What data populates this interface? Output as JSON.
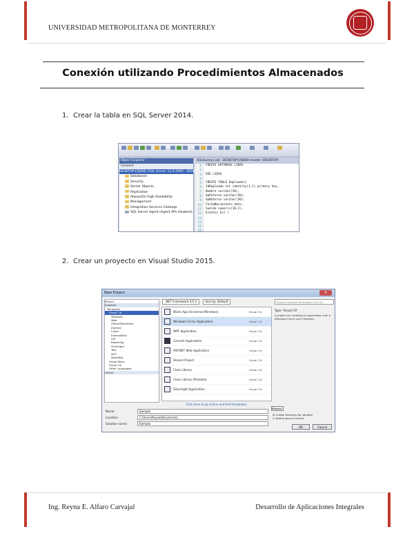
{
  "header": {
    "university": "UNIVERSIDAD METROPOLITANA DE MONTERREY",
    "seal_color": "#b32025",
    "accent_color": "#c0392b"
  },
  "title": "Conexión utilizando Procedimientos Almacenados",
  "steps": [
    {
      "number": "1.",
      "text": "Crear la tabla en SQL Server 2014."
    },
    {
      "number": "2.",
      "text": "Crear un proyecto en Visual Studio 2015."
    }
  ],
  "ssms": {
    "explorer_title": "Object Explorer",
    "connect_label": "Connect",
    "server_node": "DESKTOP-E9JSKR (SQL Server 12.0.2000 - DESKTOP)",
    "tree": [
      "Databases",
      "Security",
      "Server Objects",
      "Replication",
      "AlwaysOn High Availability",
      "Management",
      "Integration Services Catalogs",
      "SQL Server Agent (Agent XPs disabled)"
    ],
    "tab_label": "SQLQuery1.sql - DESKTOP-E9JSKR.master (DESKTOP)",
    "line_numbers": [
      "1",
      "2",
      "3",
      "4",
      "5",
      "6",
      "7",
      "8",
      "9",
      "10",
      "11",
      "12",
      "13",
      "14",
      "15",
      "16"
    ],
    "code": {
      "l1": "CREATE DATABASE LIDAS",
      "l2": "USE LIDAS",
      "l3": "CREATE TABLE Empleados(",
      "l4": "IdEmpleado int identity(1,1) primary key,",
      "l5": "Nombre varchar(50),",
      "l6": "ApPaterno varchar(50),",
      "l7": "ApMaterno varchar(50),",
      "l8": "FechaNacimiento date,",
      "l9": "Sueldo numeric(18,2),",
      "l10": "Estatus bit )"
    }
  },
  "vs": {
    "caption": "New Project",
    "close": "X",
    "tree": [
      "Recent",
      "Installed",
      "Templates",
      "Visual C#",
      "Windows",
      "Web",
      "Office/SharePoint",
      "Android",
      "Cloud",
      "Extensibility",
      "iOS",
      "Reporting",
      "Silverlight",
      "Test",
      "WCF",
      "Workflow",
      "Visual Basic",
      "Visual F#",
      "Other Languages",
      "Online"
    ],
    "tree_selected": "Visual C#",
    "framework": ".NET Framework 4.5.2",
    "sort": "Sort by: Default",
    "search_placeholder": "Search Installed Templates (Ctrl+E)",
    "templates": [
      {
        "name": "Blank App (Universal Windows)",
        "lang": "Visual C#"
      },
      {
        "name": "Windows Forms Application",
        "lang": "Visual C#"
      },
      {
        "name": "WPF Application",
        "lang": "Visual C#"
      },
      {
        "name": "Console Application",
        "lang": "Visual C#"
      },
      {
        "name": "ASP.NET Web Application",
        "lang": "Visual C#"
      },
      {
        "name": "Shared Project",
        "lang": "Visual C#"
      },
      {
        "name": "Class Library",
        "lang": "Visual C#"
      },
      {
        "name": "Class Library (Portable)",
        "lang": "Visual C#"
      },
      {
        "name": "Silverlight Application",
        "lang": "Visual C#"
      }
    ],
    "online_link": "Click here to go online and find templates.",
    "type_title": "Type: Visual C#",
    "type_desc": "A project for creating an application with a Windows Forms user interface",
    "name_label": "Name:",
    "name_value": "Ejemplo",
    "location_label": "Location:",
    "location_value": "C:\\Users\\Reyna\\Documents\\",
    "solution_label": "Solution name:",
    "solution_value": "Ejemplo",
    "browse": "Browse...",
    "chk1": "Create directory for solution",
    "chk2": "Add to source control",
    "ok": "OK",
    "cancel": "Cancel"
  },
  "footer": {
    "author": "Ing. Reyna E. Alfaro Carvajal",
    "course": "Desarrollo de Aplicaciones Integrales"
  }
}
